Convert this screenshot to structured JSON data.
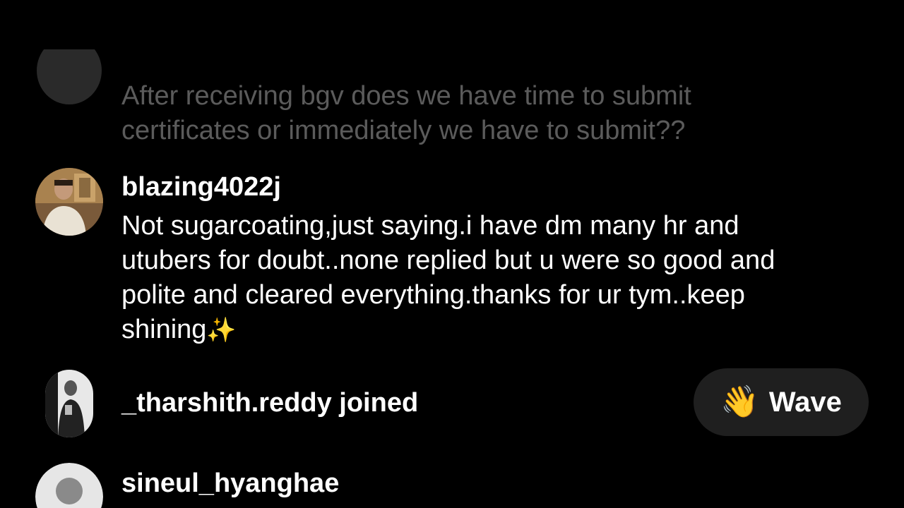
{
  "comments": [
    {
      "username": "",
      "text": "After receiving bgv does we have time to submit certificates or immediately we have to submit??"
    },
    {
      "username": "blazing4022j",
      "text": "Not sugarcoating,just saying.i have dm many hr and utubers for doubt..none replied but u were so good and polite and cleared everything.thanks for ur tym..keep shining",
      "emoji": "✨"
    }
  ],
  "join_event": {
    "text": "_tharshith.reddy joined"
  },
  "wave_button": {
    "icon": "waving-hand-icon",
    "emoji": "👋",
    "label": "Wave"
  },
  "last_comment": {
    "username": "sineul_hyanghae"
  },
  "colors": {
    "background": "#000000",
    "faded_text": "#a6a6a6",
    "wave_button_bg": "#1f1f1f"
  }
}
